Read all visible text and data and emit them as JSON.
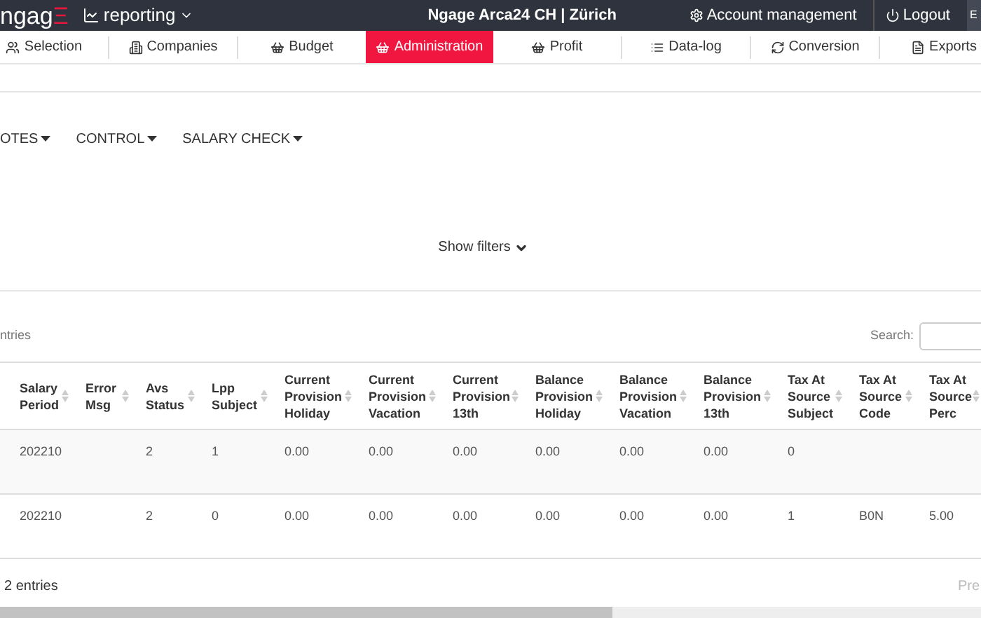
{
  "header": {
    "logo": "ngag",
    "logo_accent": "Ξ",
    "app_menu": "reporting",
    "title": "Ngage Arca24 CH | Zürich",
    "account": "Account management",
    "logout": "Logout",
    "language": "E"
  },
  "tabs": [
    {
      "label": "Selection",
      "selected": false
    },
    {
      "label": "Companies",
      "selected": false
    },
    {
      "label": "Budget",
      "selected": false
    },
    {
      "label": "Administration",
      "selected": true
    },
    {
      "label": "Profit",
      "selected": false
    },
    {
      "label": "Data-log",
      "selected": false
    },
    {
      "label": "Conversion",
      "selected": false
    },
    {
      "label": "Exports",
      "selected": false
    }
  ],
  "submenu": [
    "OTES",
    "CONTROL",
    "SALARY CHECK"
  ],
  "show_filters": "Show filters",
  "length_label": "ntries",
  "search": {
    "label": "Search:"
  },
  "table": {
    "columns": [
      "Salary Period",
      "Error Msg",
      "Avs Status",
      "Lpp Subject",
      "Current Provision Holiday",
      "Current Provision Vacation",
      "Current Provision 13th",
      "Balance Provision Holiday",
      "Balance Provision Vacation",
      "Balance Provision 13th",
      "Tax At Source Subject",
      "Tax At Source Code",
      "Tax At Source Perc"
    ],
    "rows": [
      [
        "202210",
        "",
        "2",
        "1",
        "0.00",
        "0.00",
        "0.00",
        "0.00",
        "0.00",
        "0.00",
        "0",
        "",
        ""
      ],
      [
        "202210",
        "",
        "2",
        "0",
        "0.00",
        "0.00",
        "0.00",
        "0.00",
        "0.00",
        "0.00",
        "1",
        "B0N",
        "5.00"
      ]
    ]
  },
  "info": "2 entries",
  "pager": {
    "previous": "Pre"
  }
}
